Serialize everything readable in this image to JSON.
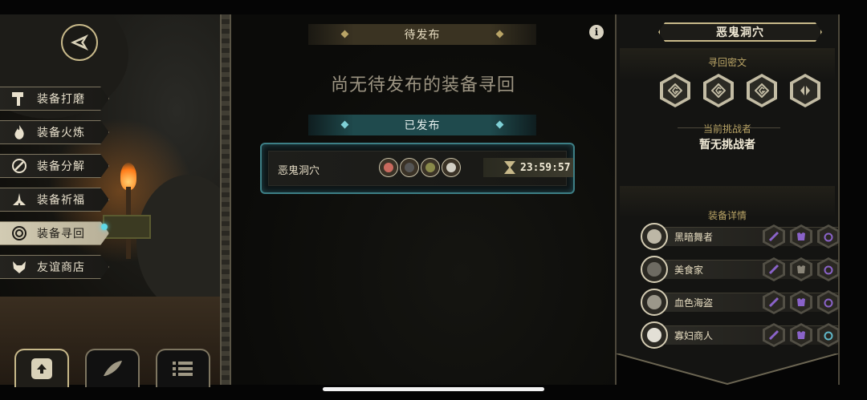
{
  "sidebar": {
    "items": [
      {
        "label": "装备打磨",
        "icon": "hammer-icon",
        "active": false
      },
      {
        "label": "装备火炼",
        "icon": "flame-icon",
        "active": false
      },
      {
        "label": "装备分解",
        "icon": "disassemble-icon",
        "active": false
      },
      {
        "label": "装备祈福",
        "icon": "blessing-icon",
        "active": false
      },
      {
        "label": "装备寻回",
        "icon": "retrieve-icon",
        "active": true
      },
      {
        "label": "友谊商店",
        "icon": "fox-icon",
        "active": false
      }
    ]
  },
  "bottom_tabs": [
    {
      "icon": "upload-arrow-icon",
      "active": true
    },
    {
      "icon": "feather-icon",
      "active": false
    },
    {
      "icon": "list-icon",
      "active": false
    }
  ],
  "center": {
    "pending_header": "待发布",
    "empty_message": "尚无待发布的装备寻回",
    "published_header": "已发布",
    "published": [
      {
        "name": "恶鬼洞穴",
        "timer": "23:59:57"
      }
    ]
  },
  "right_panel": {
    "title": "恶鬼洞穴",
    "cipher_label": "寻回密文",
    "challenger_label": "当前挑战者",
    "challenger_value": "暂无挑战者",
    "equip_label": "装备详情",
    "heroes": [
      {
        "name": "黑暗舞者"
      },
      {
        "name": "美食家"
      },
      {
        "name": "血色海盗"
      },
      {
        "name": "寡妇商人"
      }
    ]
  },
  "colors": {
    "gold": "#c8b98a",
    "teal": "#3d7f86",
    "purple": "#8a63c9",
    "cyan_ring": "#5fb7c8"
  }
}
